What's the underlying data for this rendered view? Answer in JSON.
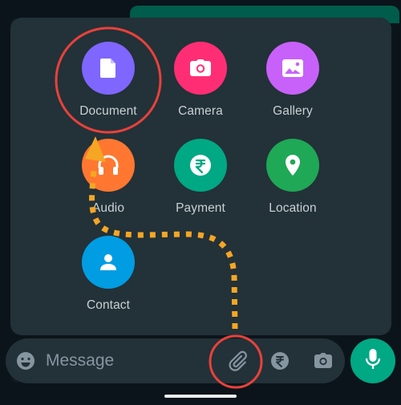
{
  "attach_menu": {
    "options": [
      {
        "label": "Document",
        "icon": "document-icon",
        "color": "#7f66ff"
      },
      {
        "label": "Camera",
        "icon": "camera-icon",
        "color": "#ff2e74"
      },
      {
        "label": "Gallery",
        "icon": "gallery-icon",
        "color": "#c861fa"
      },
      {
        "label": "Audio",
        "icon": "headphones-icon",
        "color": "#ff7730"
      },
      {
        "label": "Payment",
        "icon": "rupee-icon",
        "color": "#00a884"
      },
      {
        "label": "Location",
        "icon": "location-pin-icon",
        "color": "#1fa855"
      },
      {
        "label": "Contact",
        "icon": "contact-icon",
        "color": "#009de2"
      }
    ]
  },
  "composer": {
    "placeholder": "Message"
  },
  "colors": {
    "annotation_circle": "#e8413b",
    "annotation_arrow": "#f5a623",
    "panel": "#233138",
    "send_button": "#00a884"
  }
}
